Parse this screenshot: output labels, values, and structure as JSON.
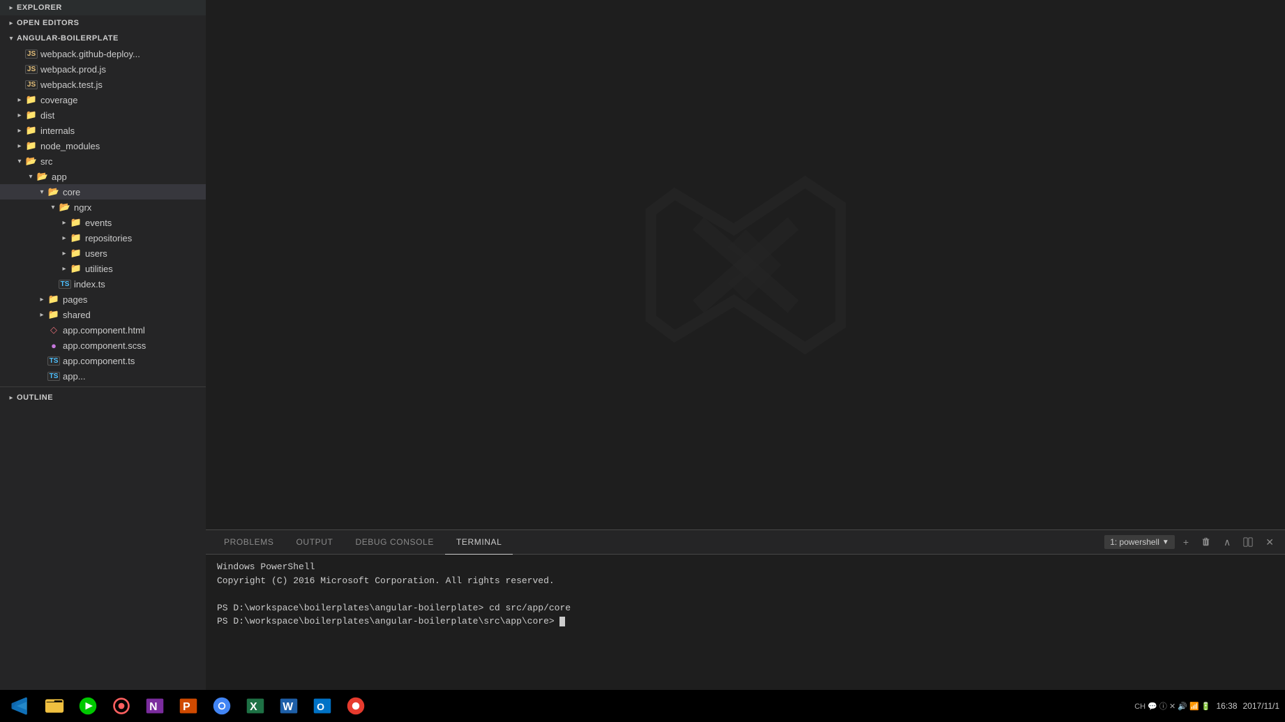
{
  "sidebar": {
    "explorer_title": "EXPLORER",
    "open_editors_title": "OPEN EDITORS",
    "project_name": "ANGULAR-BOILERPLATE",
    "files": [
      {
        "id": "webpack-deploy",
        "name": "webpack.github-deploy...",
        "type": "js",
        "indent": "indent-1",
        "arrow": false
      },
      {
        "id": "webpack-prod",
        "name": "webpack.prod.js",
        "type": "js",
        "indent": "indent-1",
        "arrow": false
      },
      {
        "id": "webpack-test",
        "name": "webpack.test.js",
        "type": "js",
        "indent": "indent-1",
        "arrow": false
      },
      {
        "id": "coverage",
        "name": "coverage",
        "type": "folder-closed",
        "indent": "indent-1",
        "arrow": true
      },
      {
        "id": "dist",
        "name": "dist",
        "type": "folder-closed",
        "indent": "indent-1",
        "arrow": true
      },
      {
        "id": "internals",
        "name": "internals",
        "type": "folder-closed",
        "indent": "indent-1",
        "arrow": true
      },
      {
        "id": "node_modules",
        "name": "node_modules",
        "type": "folder-closed",
        "indent": "indent-1",
        "arrow": true
      },
      {
        "id": "src",
        "name": "src",
        "type": "folder-open",
        "indent": "indent-1",
        "arrow": true
      },
      {
        "id": "app",
        "name": "app",
        "type": "folder-open",
        "indent": "indent-2",
        "arrow": true
      },
      {
        "id": "core",
        "name": "core",
        "type": "folder-open",
        "indent": "indent-3",
        "arrow": true,
        "active": true
      },
      {
        "id": "ngrx",
        "name": "ngrx",
        "type": "folder-open",
        "indent": "indent-4",
        "arrow": true
      },
      {
        "id": "events",
        "name": "events",
        "type": "folder-closed",
        "indent": "indent-5",
        "arrow": true
      },
      {
        "id": "repositories",
        "name": "repositories",
        "type": "folder-closed",
        "indent": "indent-5",
        "arrow": true
      },
      {
        "id": "users",
        "name": "users",
        "type": "folder-closed",
        "indent": "indent-5",
        "arrow": true
      },
      {
        "id": "utilities",
        "name": "utilities",
        "type": "folder-closed",
        "indent": "indent-5",
        "arrow": true
      },
      {
        "id": "index-ts",
        "name": "index.ts",
        "type": "ts",
        "indent": "indent-4",
        "arrow": false
      },
      {
        "id": "pages",
        "name": "pages",
        "type": "folder-closed",
        "indent": "indent-3",
        "arrow": true
      },
      {
        "id": "shared",
        "name": "shared",
        "type": "folder-closed",
        "indent": "indent-3",
        "arrow": true
      },
      {
        "id": "app-component-html",
        "name": "app.component.html",
        "type": "html",
        "indent": "indent-3",
        "arrow": false
      },
      {
        "id": "app-component-scss",
        "name": "app.component.scss",
        "type": "scss",
        "indent": "indent-3",
        "arrow": false
      },
      {
        "id": "app-component-ts",
        "name": "app.component.ts",
        "type": "ts",
        "indent": "indent-3",
        "arrow": false
      },
      {
        "id": "app-ts-more",
        "name": "app...",
        "type": "ts",
        "indent": "indent-3",
        "arrow": false
      }
    ],
    "outline_title": "OUTLINE"
  },
  "terminal": {
    "tabs": [
      {
        "id": "problems",
        "label": "PROBLEMS"
      },
      {
        "id": "output",
        "label": "OUTPUT"
      },
      {
        "id": "debug-console",
        "label": "DEBUG CONSOLE"
      },
      {
        "id": "terminal",
        "label": "TERMINAL",
        "active": true
      }
    ],
    "shell_selector": "1: powershell",
    "lines": [
      "Windows PowerShell",
      "Copyright (C) 2016 Microsoft Corporation. All rights reserved.",
      "",
      "PS D:\\workspace\\boilerplates\\angular-boilerplate> cd src/app/core",
      "PS D:\\workspace\\boilerplates\\angular-boilerplate\\src\\app\\core> "
    ],
    "buttons": {
      "add": "+",
      "delete": "🗑",
      "chevron_up": "∧",
      "split": "⬜",
      "close": "✕"
    }
  },
  "taskbar": {
    "time": "16:38",
    "date": "2017/11/1"
  }
}
